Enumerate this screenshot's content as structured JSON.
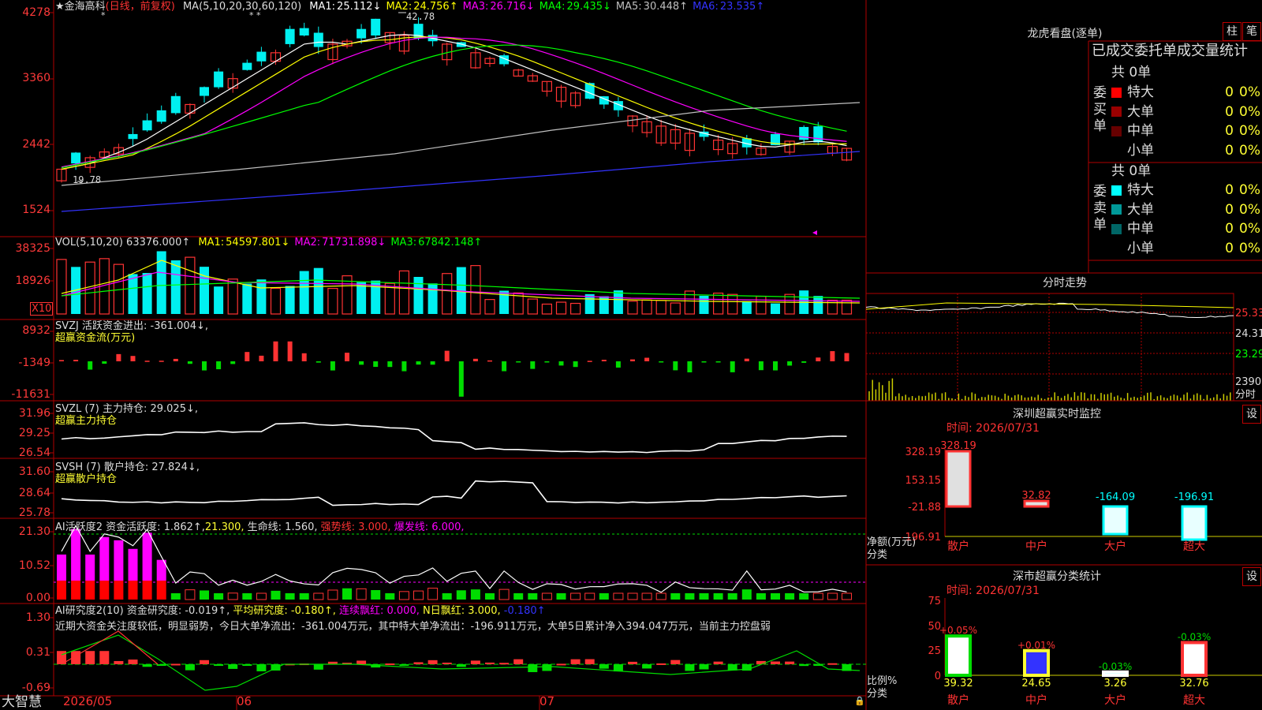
{
  "colors": {
    "up": "#ff3333",
    "down": "#00f0f0",
    "grid": "#b00000",
    "ma1": "#ffffff",
    "ma2": "#ffff00",
    "ma3": "#ff00ff",
    "ma4": "#00ff00",
    "ma5": "#c0c0c0",
    "ma6": "#3333ff",
    "text": "#dddddd",
    "yellow": "#ffff33"
  },
  "main": {
    "star": "★",
    "stock_name": "金海高科",
    "period_note": "(日线，前复权)",
    "ma_header": "MA(5,10,20,30,60,120)",
    "ma": [
      {
        "label": "MA1:",
        "value": "25.112↓",
        "color": "#ffffff"
      },
      {
        "label": "MA2:",
        "value": "24.756↑",
        "color": "#ffff00"
      },
      {
        "label": "MA3:",
        "value": "26.716↓",
        "color": "#ff00ff"
      },
      {
        "label": "MA4:",
        "value": "29.435↓",
        "color": "#00ff00"
      },
      {
        "label": "MA5:",
        "value": "30.448↑",
        "color": "#c0c0c0"
      },
      {
        "label": "MA6:",
        "value": "23.535↑",
        "color": "#3333ff"
      }
    ],
    "high_marker": "42.78",
    "low_marker": "19.78",
    "y_ticks": [
      "4278",
      "3360",
      "2442",
      "1524"
    ]
  },
  "vol": {
    "header": "VOL(5,10,20)",
    "value": "63376.000↑",
    "ma": [
      {
        "label": "MA1:",
        "value": "54597.801↓",
        "color": "#ffff00"
      },
      {
        "label": "MA2:",
        "value": "71731.898↓",
        "color": "#ff00ff"
      },
      {
        "label": "MA3:",
        "value": "67842.148↑",
        "color": "#00ff00"
      }
    ],
    "y_ticks": [
      "38325",
      "18926"
    ],
    "unit": "X10"
  },
  "svzj": {
    "title": "SVZJ  活跃资金进出: -361.004↓,",
    "subtitle": "超赢资金流(万元)",
    "y_ticks": [
      "8932",
      "-1349",
      "-11631"
    ]
  },
  "svzl": {
    "title": "SVZL (7) 主力持仓: 29.025↓,",
    "subtitle": "超赢主力持仓",
    "y_ticks": [
      "31.96",
      "29.25",
      "26.54"
    ]
  },
  "svsh": {
    "title": "SVSH (7) 散户持仓: 27.824↓,",
    "subtitle": "超赢散户持仓",
    "y_ticks": [
      "31.60",
      "28.64",
      "25.78"
    ]
  },
  "ai_active": {
    "title": "AI活跃度2 资金活跃度: 1.862↑,",
    "v1": "21.300,",
    "life": "生命线: 1.560,",
    "strong": "强势线: 3.000,",
    "burst": "爆发线: 6.000,",
    "y_ticks": [
      "21.30",
      "10.52",
      "0.00"
    ]
  },
  "ai_research": {
    "title": "AI研究度2(10) 资金研究度: -0.019↑,",
    "avg": "平均研究度: -0.180↑,",
    "streak": "连续飘红: 0.000,",
    "nday": "N日飘红: 3.000,",
    "last": "-0.180↑",
    "commentary": "近期大资金关注度较低，明显弱势，今日大单净流出：-361.004万元，其中特大单净流出：-196.911万元，大单5日累计净入394.047万元，当前主力控盘弱",
    "y_ticks": [
      "1.30",
      "0.31",
      "-0.69"
    ]
  },
  "bottom_bar": {
    "brand": "大智慧",
    "dates": [
      "2026/05",
      "06",
      "07"
    ]
  },
  "right_panel": {
    "title": "龙虎看盘(逐单)",
    "btn_column": "柱",
    "btn_pen": "笔",
    "stats_title": "已成交委托单成交量统计",
    "buy": {
      "side_label": "委买单",
      "total": "共 0单",
      "rows": [
        {
          "label": "特大",
          "count": "0",
          "pct": "0%",
          "color": "#ff0000"
        },
        {
          "label": "大单",
          "count": "0",
          "pct": "0%",
          "color": "#990000"
        },
        {
          "label": "中单",
          "count": "0",
          "pct": "0%",
          "color": "#660000"
        },
        {
          "label": "小单",
          "count": "0",
          "pct": "0%",
          "color": "#000000"
        }
      ]
    },
    "sell": {
      "side_label": "委卖单",
      "total": "共 0单",
      "rows": [
        {
          "label": "特大",
          "count": "0",
          "pct": "0%",
          "color": "#00ffff"
        },
        {
          "label": "大单",
          "count": "0",
          "pct": "0%",
          "color": "#009999"
        },
        {
          "label": "中单",
          "count": "0",
          "pct": "0%",
          "color": "#006666"
        },
        {
          "label": "小单",
          "count": "0",
          "pct": "0%",
          "color": "#000000"
        }
      ]
    },
    "intraday": {
      "title": "分时走势",
      "y_ticks": [
        "25.33",
        "24.31",
        "23.29"
      ],
      "vol_tick": "2390",
      "label": "分时"
    },
    "monitor": {
      "title": "深圳超赢实时监控",
      "settings": "设",
      "time": "时间: 2026/07/31",
      "y_ticks": [
        "328.19",
        "153.15",
        "-21.88",
        "-196.91"
      ],
      "axis_label": "净额(万元)",
      "axis_label2": "分类",
      "bars": [
        {
          "category": "散户",
          "value": 328.19,
          "label": "328.19"
        },
        {
          "category": "中户",
          "value": 32.82,
          "label": "32.82"
        },
        {
          "category": "大户",
          "value": -164.09,
          "label": "-164.09"
        },
        {
          "category": "超大",
          "value": -196.91,
          "label": "-196.91"
        }
      ]
    },
    "class_stats": {
      "title": "深市超赢分类统计",
      "settings": "设",
      "time": "时间: 2026/07/31",
      "y_ticks": [
        "75",
        "50",
        "25",
        "0"
      ],
      "axis_label": "比例%",
      "axis_label2": "分类",
      "bars": [
        {
          "category": "散户",
          "value": 39.32,
          "label": "39.32",
          "change": "+0.05%"
        },
        {
          "category": "中户",
          "value": 24.65,
          "label": "24.65",
          "change": "+0.01%"
        },
        {
          "category": "大户",
          "value": 3.26,
          "label": "3.26",
          "change": "-0.03%"
        },
        {
          "category": "超大",
          "value": 32.76,
          "label": "32.76",
          "change": "-0.03%"
        }
      ]
    }
  }
}
